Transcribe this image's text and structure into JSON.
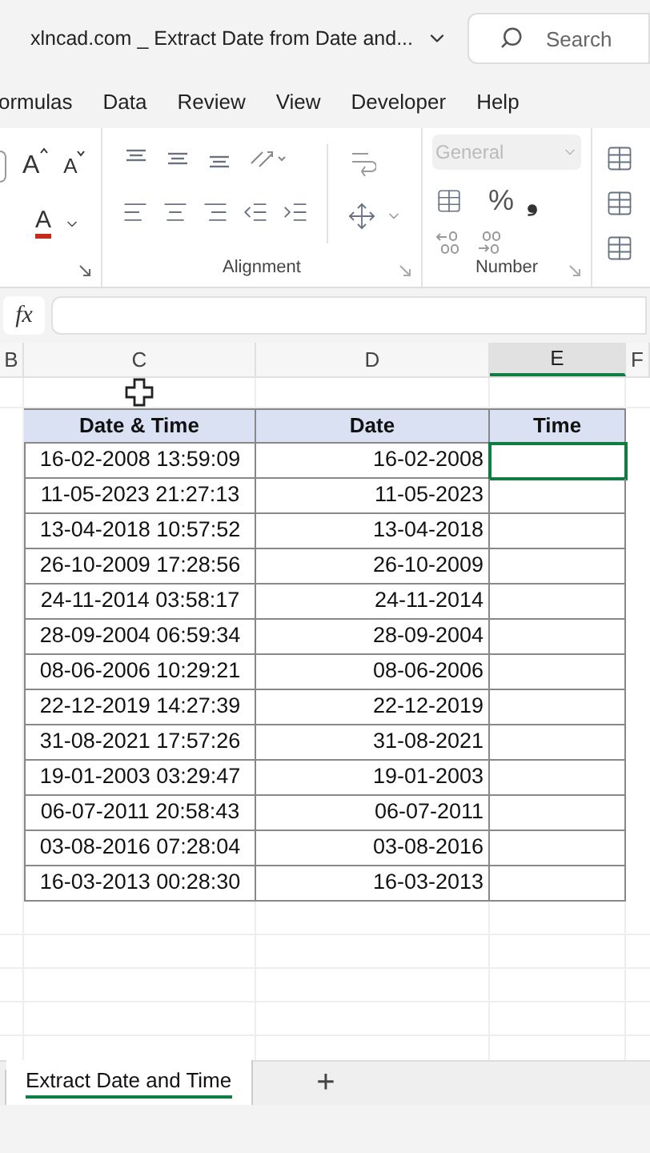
{
  "window": {
    "title": "xlncad.com _ Extract Date from Date and...",
    "search": {
      "placeholder": "Search"
    }
  },
  "menu": [
    {
      "label": "ormulas"
    },
    {
      "label": "Data"
    },
    {
      "label": "Review"
    },
    {
      "label": "View"
    },
    {
      "label": "Developer"
    },
    {
      "label": "Help"
    }
  ],
  "ribbon": {
    "groups": [
      {
        "label": "Alignment"
      },
      {
        "label": "Number"
      }
    ],
    "number_format": {
      "value": "General",
      "disabled": true
    },
    "percent": "%",
    "comma": "❟",
    "font_color": "A",
    "grow_font": "A",
    "shrink_font": "A"
  },
  "formula_bar": {
    "fx": "fx"
  },
  "columns": [
    {
      "label": "B",
      "selected": false
    },
    {
      "label": "C",
      "selected": false
    },
    {
      "label": "D",
      "selected": false
    },
    {
      "label": "E",
      "selected": true
    },
    {
      "label": "F",
      "selected": false
    }
  ],
  "table": {
    "columns": [
      "Date & Time",
      "Date",
      "Time"
    ],
    "rows": [
      {
        "datetime": "16-02-2008 13:59:09",
        "date": "16-02-2008",
        "selected": true
      },
      {
        "datetime": "11-05-2023 21:27:13",
        "date": "11-05-2023",
        "selected": false
      },
      {
        "datetime": "13-04-2018 10:57:52",
        "date": "13-04-2018",
        "selected": false
      },
      {
        "datetime": "26-10-2009 17:28:56",
        "date": "26-10-2009",
        "selected": false
      },
      {
        "datetime": "24-11-2014 03:58:17",
        "date": "24-11-2014",
        "selected": false
      },
      {
        "datetime": "28-09-2004 06:59:34",
        "date": "28-09-2004",
        "selected": false
      },
      {
        "datetime": "08-06-2006 10:29:21",
        "date": "08-06-2006",
        "selected": false
      },
      {
        "datetime": "22-12-2019 14:27:39",
        "date": "22-12-2019",
        "selected": false
      },
      {
        "datetime": "31-08-2021 17:57:26",
        "date": "31-08-2021",
        "selected": false
      },
      {
        "datetime": "19-01-2003 03:29:47",
        "date": "19-01-2003",
        "selected": false
      },
      {
        "datetime": "06-07-2011 20:58:43",
        "date": "06-07-2011",
        "selected": false
      },
      {
        "datetime": "03-08-2016 07:28:04",
        "date": "03-08-2016",
        "selected": false
      },
      {
        "datetime": "16-03-2013 00:28:30",
        "date": "16-03-2013",
        "selected": false
      }
    ]
  },
  "sheet_tabs": [
    {
      "label": "Extract Date and Time",
      "selected": true
    }
  ],
  "add_sheet": "+"
}
